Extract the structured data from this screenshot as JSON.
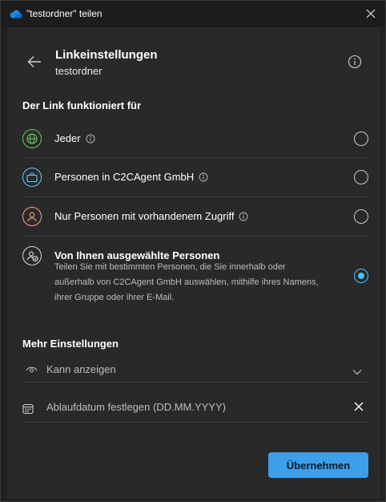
{
  "window": {
    "title": "\"testordner\" teilen"
  },
  "header": {
    "title": "Linkeinstellungen",
    "subtitle": "testordner"
  },
  "link_section": {
    "title": "Der Link funktioniert für",
    "options": [
      {
        "label": "Jeder",
        "has_info": true,
        "selected": false,
        "icon": "globe-icon"
      },
      {
        "label": "Personen in C2CAgent GmbH",
        "has_info": true,
        "selected": false,
        "icon": "briefcase-icon"
      },
      {
        "label": "Nur Personen mit vorhandenem Zugriff",
        "has_info": true,
        "selected": false,
        "icon": "person-icon"
      },
      {
        "label": "Von Ihnen ausgewählte Personen",
        "description": "Teilen Sie mit bestimmten Personen, die Sie innerhalb oder außerhalb von C2CAgent GmbH auswählen, mithilfe ihres Namens, ihrer Gruppe oder ihrer E-Mail.",
        "selected": true,
        "icon": "people-icon"
      }
    ]
  },
  "more_settings": {
    "title": "Mehr Einstellungen",
    "permission": "Kann anzeigen",
    "expiry_placeholder": "Ablaufdatum festlegen (DD.MM.YYYY)",
    "expiry_value": ""
  },
  "apply_label": "Übernehmen",
  "colors": {
    "accent": "#4cc2ff",
    "button": "#3f9ee8",
    "globe": "#6ccb5f",
    "briefcase": "#60cdff",
    "person": "#f7a589"
  }
}
